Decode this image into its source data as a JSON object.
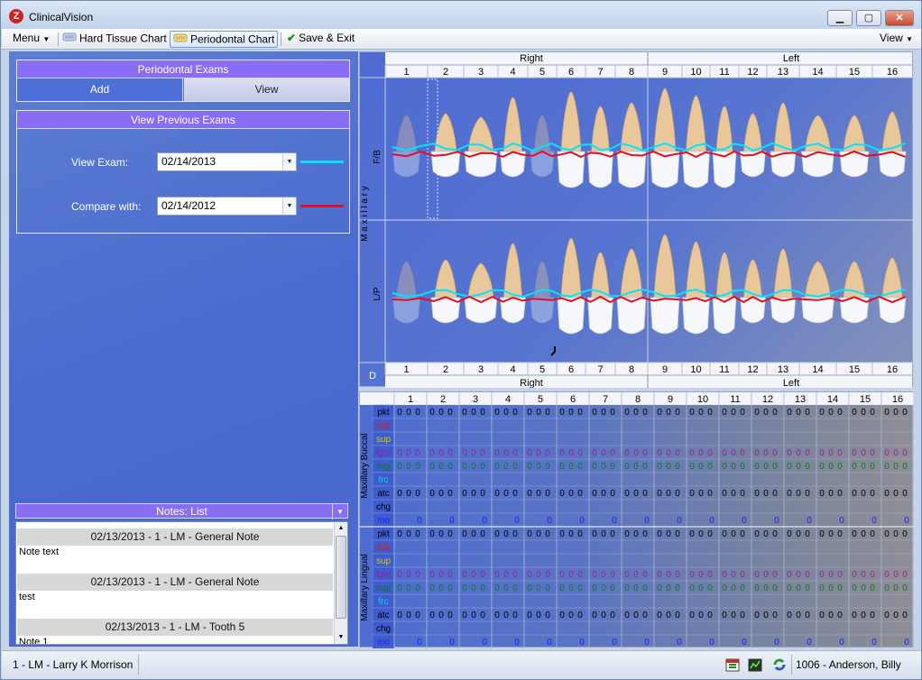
{
  "window": {
    "title": "ClinicalVision",
    "logo_letter": "Z"
  },
  "toolbar": {
    "menu": "Menu",
    "hard_tissue": "Hard Tissue Chart",
    "periodontal": "Periodontal Chart",
    "save_exit": "Save & Exit",
    "view": "View"
  },
  "exams_panel": {
    "title": "Periodontal Exams",
    "add": "Add",
    "view": "View"
  },
  "prev_panel": {
    "title": "View Previous Exams",
    "view_label": "View Exam:",
    "view_value": "02/14/2013",
    "view_color": "#00e5ff",
    "compare_label": "Compare with:",
    "compare_value": "02/14/2012",
    "compare_color": "#e01020"
  },
  "notes": {
    "title": "Notes: List",
    "items": [
      {
        "header": "02/13/2013 - 1 - LM - General Note",
        "text": "Note text"
      },
      {
        "header": "02/13/2013 - 1 - LM - General Note",
        "text": "test"
      },
      {
        "header": "02/13/2013 - 1 - LM - Tooth 5",
        "text": "Note 1"
      }
    ]
  },
  "chart": {
    "right": "Right",
    "left": "Left",
    "vertical_label": "M a x i l l a r y",
    "fb": "F/B",
    "lp": "L/P",
    "d": "D",
    "teeth": [
      "1",
      "2",
      "3",
      "4",
      "5",
      "6",
      "7",
      "8",
      "9",
      "10",
      "11",
      "12",
      "13",
      "14",
      "15",
      "16"
    ]
  },
  "grid": {
    "buccal_label": "Maxillary Buccal",
    "lingual_label": "Maxillary Lingual",
    "rows": [
      {
        "k": "pkt",
        "c": "#000000",
        "v": "0 0 0"
      },
      {
        "k": "bld",
        "c": "#e01818",
        "v": ""
      },
      {
        "k": "sup",
        "c": "#d8c800",
        "v": ""
      },
      {
        "k": "fgm",
        "c": "#9a209a",
        "v": "0 0 0"
      },
      {
        "k": "mgj",
        "c": "#0a7a22",
        "v": "0 0 0"
      },
      {
        "k": "frc",
        "c": "#00d8e8",
        "v": ""
      },
      {
        "k": "atc",
        "c": "#000000",
        "v": "0 0 0"
      },
      {
        "k": "chg",
        "c": "#000000",
        "v": ""
      },
      {
        "k": "mo",
        "c": "#1a1aff",
        "v": "0"
      }
    ]
  },
  "status": {
    "provider": "1 - LM - Larry K Morrison",
    "patient": "1006 - Anderson, Billy"
  }
}
